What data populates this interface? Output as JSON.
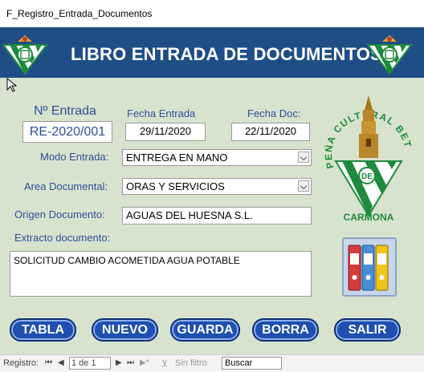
{
  "window": {
    "title": "F_Registro_Entrada_Documentos"
  },
  "header": {
    "title": "LIBRO ENTRADA DE DOCUMENTOS"
  },
  "form": {
    "numero_label": "Nº Entrada",
    "numero_value": "RE-2020/001",
    "fecha_entrada_label": "Fecha Entrada",
    "fecha_entrada_value": "29/11/2020",
    "fecha_doc_label": "Fecha Doc:",
    "fecha_doc_value": "22/11/2020",
    "modo_label": "Modo Entrada:",
    "modo_value": "ENTREGA EN MANO",
    "area_label": "Area Documental:",
    "area_value": "ORAS Y SERVICIOS",
    "origen_label": "Origen  Documento:",
    "origen_value": "AGUAS DEL HUESNA S.L.",
    "extracto_label": "Extracto documento:",
    "extracto_value": "SOLICITUD CAMBIO ACOMETIDA AGUA POTABLE"
  },
  "logo": {
    "line1": "PEÑA CULTURAL BETICA",
    "de": "DE",
    "city": "CARMONA"
  },
  "buttons": {
    "tabla": "TABLA",
    "nuevo": "NUEVO",
    "guarda": "GUARDA",
    "borra": "BORRA",
    "salir": "SALIR"
  },
  "statusbar": {
    "registro_label": "Registro:",
    "record_value": "1 de 1",
    "filter_label": "Sin filtro",
    "search_value": "Buscar"
  },
  "colors": {
    "header": "#1f4e86",
    "form_bg": "#d8e3cd",
    "button": "#1f4fb0",
    "label": "#2c4f9c",
    "betis_green": "#1e8a3c"
  }
}
